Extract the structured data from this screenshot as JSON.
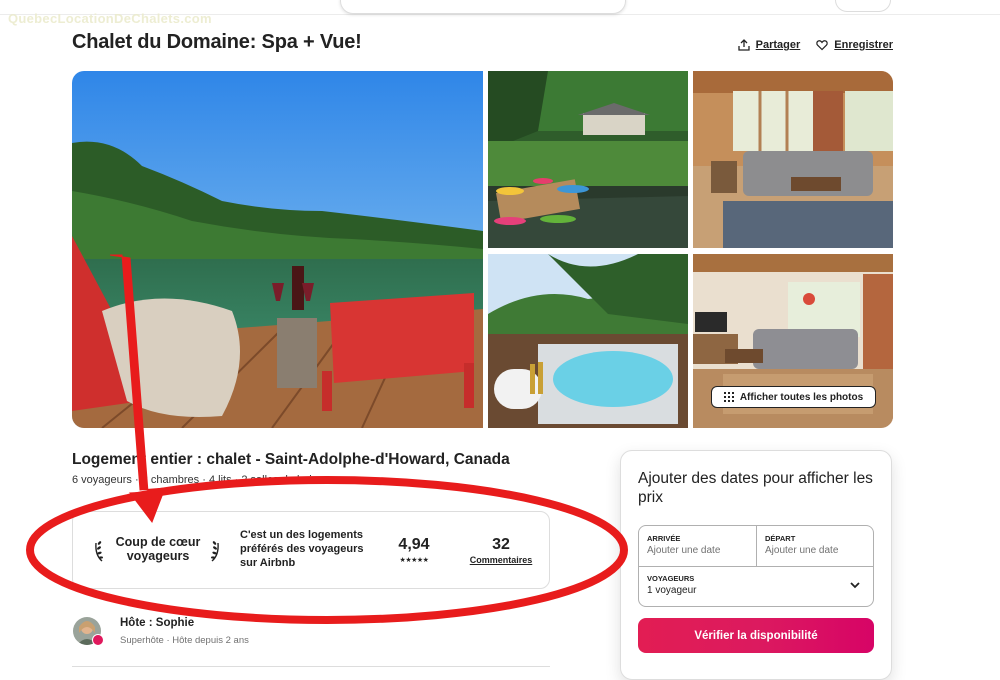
{
  "watermark": "QuebecLocationDeChalets.com",
  "listing": {
    "title": "Chalet du Domaine: Spa + Vue!",
    "share_label": "Partager",
    "save_label": "Enregistrer",
    "show_all_photos_label": "Afficher toutes les photos",
    "subtitle": "Logement entier : chalet - Saint-Adolphe-d'Howard, Canada",
    "meta": "6 voyageurs · 3 chambres · 4 lits · 2 salles de bains"
  },
  "favorite": {
    "title": "Coup de cœur voyageurs",
    "description": "C'est un des logements préférés des voyageurs sur Airbnb",
    "rating": "4,94",
    "stars": "★★★★★",
    "reviews_count": "32",
    "reviews_label": "Commentaires"
  },
  "host": {
    "name": "Hôte : Sophie",
    "subtitle": "Superhôte · Hôte depuis 2 ans"
  },
  "booking": {
    "title": "Ajouter des dates pour afficher les prix",
    "checkin_label": "ARRIVÉE",
    "checkin_placeholder": "Ajouter une date",
    "checkout_label": "DÉPART",
    "checkout_placeholder": "Ajouter une date",
    "guests_label": "VOYAGEURS",
    "guests_value": "1 voyageur",
    "cta_label": "Vérifier la disponibilité"
  },
  "icons": {
    "share": "share-icon",
    "save": "heart-icon",
    "grid": "grid-icon",
    "laurel": "laurel-icon",
    "chevron": "chevron-down-icon"
  },
  "colors": {
    "brand": "#e21d53",
    "annotation": "#e81c1c",
    "text": "#222222",
    "muted": "#717171",
    "border": "#dddddd"
  }
}
